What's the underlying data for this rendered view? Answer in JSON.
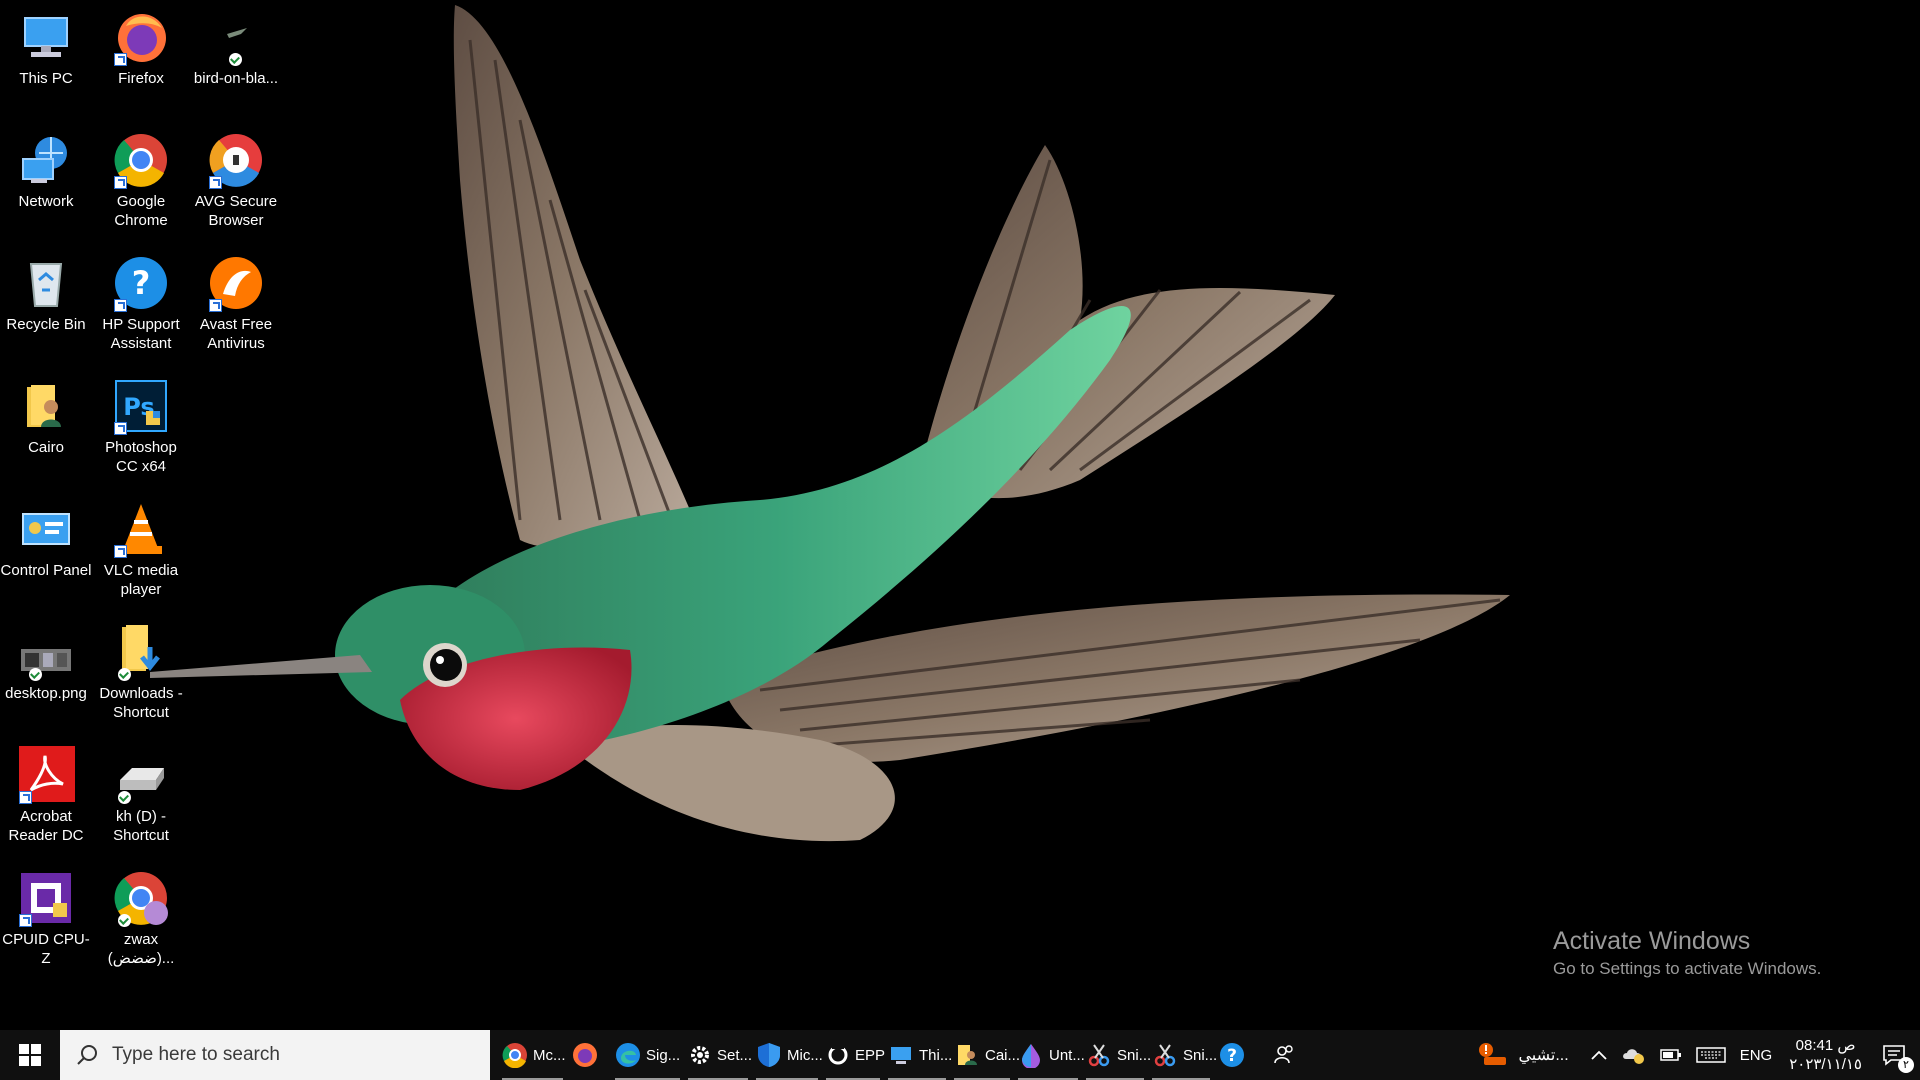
{
  "desktop": {
    "icons": [
      {
        "label": "This PC",
        "icon": "this-pc-icon"
      },
      {
        "label": "Firefox",
        "icon": "firefox-icon"
      },
      {
        "label": "bird-on-bla...",
        "icon": "image-file-icon"
      },
      {
        "label": "Network",
        "icon": "network-icon"
      },
      {
        "label": "Google Chrome",
        "icon": "chrome-icon"
      },
      {
        "label": "AVG Secure Browser",
        "icon": "avg-browser-icon"
      },
      {
        "label": "Recycle Bin",
        "icon": "recycle-bin-icon"
      },
      {
        "label": "HP Support Assistant",
        "icon": "hp-support-icon"
      },
      {
        "label": "Avast Free Antivirus",
        "icon": "avast-icon"
      },
      {
        "label": "Cairo",
        "icon": "user-folder-icon"
      },
      {
        "label": "Photoshop CC x64",
        "icon": "photoshop-icon"
      },
      {
        "label": "Control Panel",
        "icon": "control-panel-icon"
      },
      {
        "label": "VLC media player",
        "icon": "vlc-icon"
      },
      {
        "label": "desktop.png",
        "icon": "image-file-icon"
      },
      {
        "label": "Downloads - Shortcut",
        "icon": "downloads-folder-icon"
      },
      {
        "label": "Acrobat Reader DC",
        "icon": "acrobat-icon"
      },
      {
        "label": "kh (D) - Shortcut",
        "icon": "drive-icon"
      },
      {
        "label": "CPUID CPU-Z",
        "icon": "cpuz-icon"
      },
      {
        "label": "zwax (ضضض)...",
        "icon": "chrome-profile-icon"
      }
    ]
  },
  "watermark": {
    "title": "Activate Windows",
    "subtitle": "Go to Settings to activate Windows."
  },
  "taskbar": {
    "search_placeholder": "Type here to search",
    "apps": [
      {
        "label": "Mc...",
        "icon": "chrome-icon"
      },
      {
        "label": "",
        "icon": "firefox-icon"
      },
      {
        "label": "Sig...",
        "icon": "edge-icon"
      },
      {
        "label": "Set...",
        "icon": "gear-icon"
      },
      {
        "label": "Mic...",
        "icon": "defender-shield-icon"
      },
      {
        "label": "EPP",
        "icon": "epp-icon"
      },
      {
        "label": "Thi...",
        "icon": "this-pc-icon"
      },
      {
        "label": "Cai...",
        "icon": "user-folder-icon"
      },
      {
        "label": "Unt...",
        "icon": "paint-drop-icon"
      },
      {
        "label": "Sni...",
        "icon": "snipping-tool-icon"
      },
      {
        "label": "Sni...",
        "icon": "snipping-tool-icon"
      },
      {
        "label": "",
        "icon": "help-icon"
      },
      {
        "label": "",
        "icon": "people-icon"
      }
    ],
    "tray": {
      "notification_label": "تشيي...",
      "language": "ENG",
      "time": "08:41 ص",
      "date": "٢٠٢٣/١١/١٥",
      "notification_count": "٢"
    }
  },
  "colors": {
    "taskbar_bg": "#101010",
    "search_bg": "#f3f3f3",
    "watermark": "#9a9a9a",
    "desktop_bg": "#000000"
  }
}
